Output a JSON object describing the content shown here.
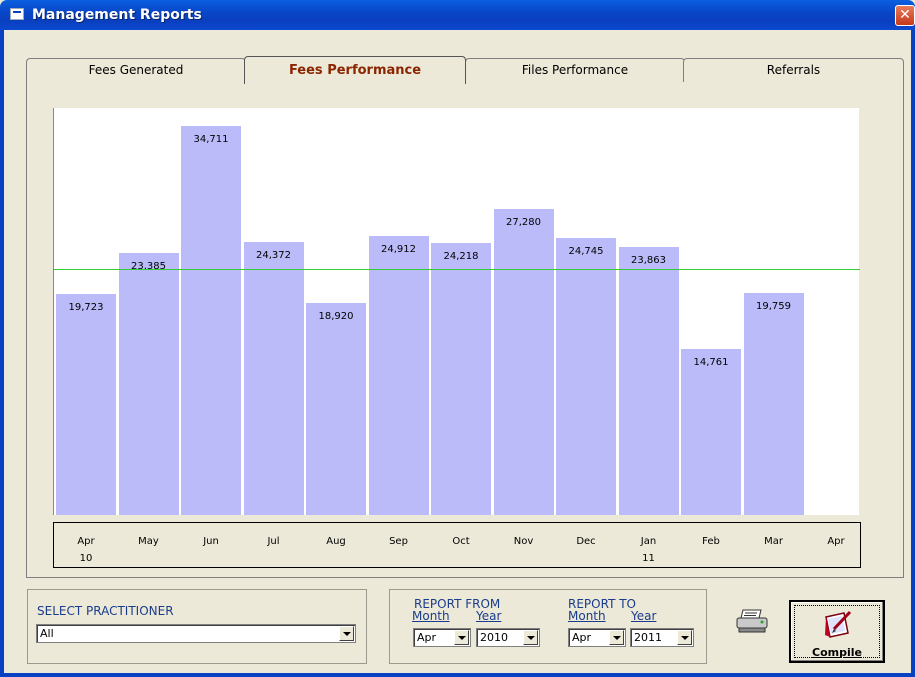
{
  "window": {
    "title": "Management Reports",
    "close_glyph": "✕"
  },
  "tabs": [
    {
      "label": "Fees Generated",
      "active": false
    },
    {
      "label": "Fees Performance",
      "active": true
    },
    {
      "label": "Files Performance",
      "active": false
    },
    {
      "label": "Referrals",
      "active": false
    }
  ],
  "chart_data": {
    "type": "bar",
    "categories": [
      "Apr",
      "May",
      "Jun",
      "Jul",
      "Aug",
      "Sep",
      "Oct",
      "Nov",
      "Dec",
      "Jan",
      "Feb",
      "Mar",
      "Apr"
    ],
    "category_sublabels": [
      "10",
      "",
      "",
      "",
      "",
      "",
      "",
      "",
      "",
      "11",
      "",
      "",
      ""
    ],
    "values": [
      19723,
      23385,
      34711,
      24372,
      18920,
      24912,
      24218,
      27280,
      24745,
      23863,
      14761,
      19759,
      null
    ],
    "value_labels": [
      "19,723",
      "23,385",
      "34,711",
      "24,372",
      "18,920",
      "24,912",
      "24,218",
      "27,280",
      "24,745",
      "23,863",
      "14,761",
      "19,759",
      ""
    ],
    "reference_line": 21900,
    "ylim": [
      0,
      36300
    ],
    "colors": {
      "bar": "#bbbbf9",
      "reference_line": "#33cc33"
    },
    "title": "",
    "xlabel": "",
    "ylabel": ""
  },
  "practitioner": {
    "label": "SELECT PRACTITIONER",
    "value": "All"
  },
  "report_from": {
    "label": "REPORT FROM",
    "month_label": "Month",
    "year_label": "Year",
    "month": "Apr",
    "year": "2010"
  },
  "report_to": {
    "label": "REPORT TO",
    "month_label": "Month",
    "year_label": "Year",
    "month": "Apr",
    "year": "2011"
  },
  "actions": {
    "compile_label": "Compile",
    "print_icon": "printer-icon"
  }
}
